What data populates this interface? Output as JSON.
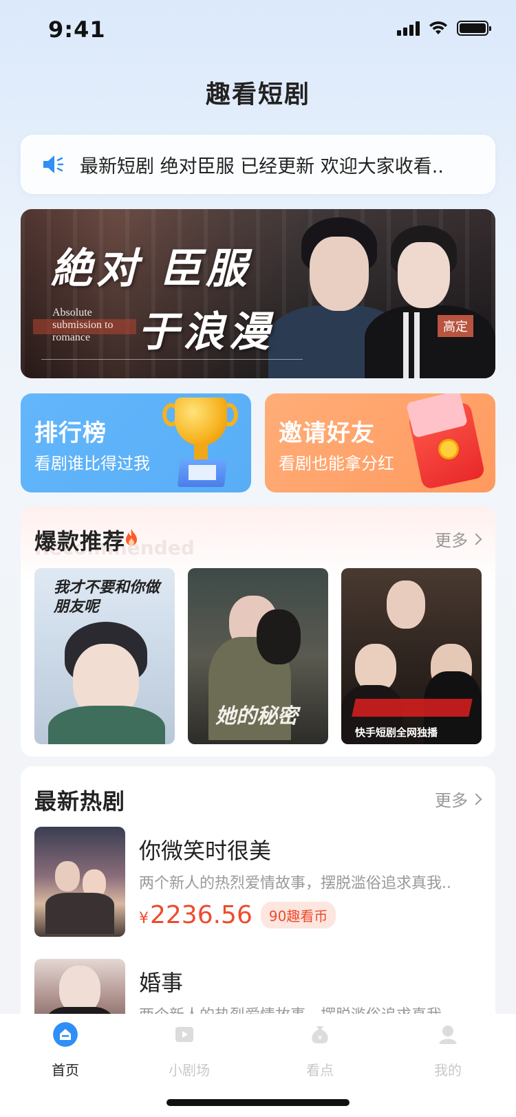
{
  "status": {
    "time": "9:41"
  },
  "header": {
    "title": "趣看短剧"
  },
  "notice": {
    "icon": "speaker-icon",
    "text": "最新短剧 绝对臣服 已经更新 欢迎大家收看.."
  },
  "banner": {
    "title_line1": "絶对 臣服",
    "title_line2": "于浪漫",
    "english": "Absolute submission to romance",
    "tag": "高定"
  },
  "entries": [
    {
      "title": "排行榜",
      "subtitle": "看剧谁比得过我",
      "icon": "trophy-icon",
      "color": "#5fb3fa"
    },
    {
      "title": "邀请好友",
      "subtitle": "看剧也能拿分红",
      "icon": "red-envelope-icon",
      "color": "#ffa46b"
    }
  ],
  "hot": {
    "title": "爆款推荐",
    "watermark": "Recommended",
    "more_label": "更多",
    "posters": [
      {
        "caption": "我才不要和你做朋友呢"
      },
      {
        "caption": "她的秘密"
      },
      {
        "caption": "快手短剧全网独播"
      }
    ]
  },
  "latest": {
    "title": "最新热剧",
    "more_label": "更多",
    "items": [
      {
        "name": "你微笑时很美",
        "desc": "两个新人的热烈爱情故事，摆脱滥俗追求真我..",
        "price_symbol": "¥",
        "price": "2236.56",
        "coins": "90趣看币"
      },
      {
        "name": "婚事",
        "desc": "两个新人的热烈爱情故事，摆脱滥俗追求真我.."
      }
    ]
  },
  "tabbar": {
    "tabs": [
      {
        "label": "首页",
        "icon": "home-icon",
        "active": true
      },
      {
        "label": "小剧场",
        "icon": "video-icon",
        "active": false
      },
      {
        "label": "看点",
        "icon": "money-bag-icon",
        "active": false
      },
      {
        "label": "我的",
        "icon": "profile-icon",
        "active": false
      }
    ]
  },
  "colors": {
    "accent": "#2f8ff6",
    "price": "#ef4a2c"
  }
}
